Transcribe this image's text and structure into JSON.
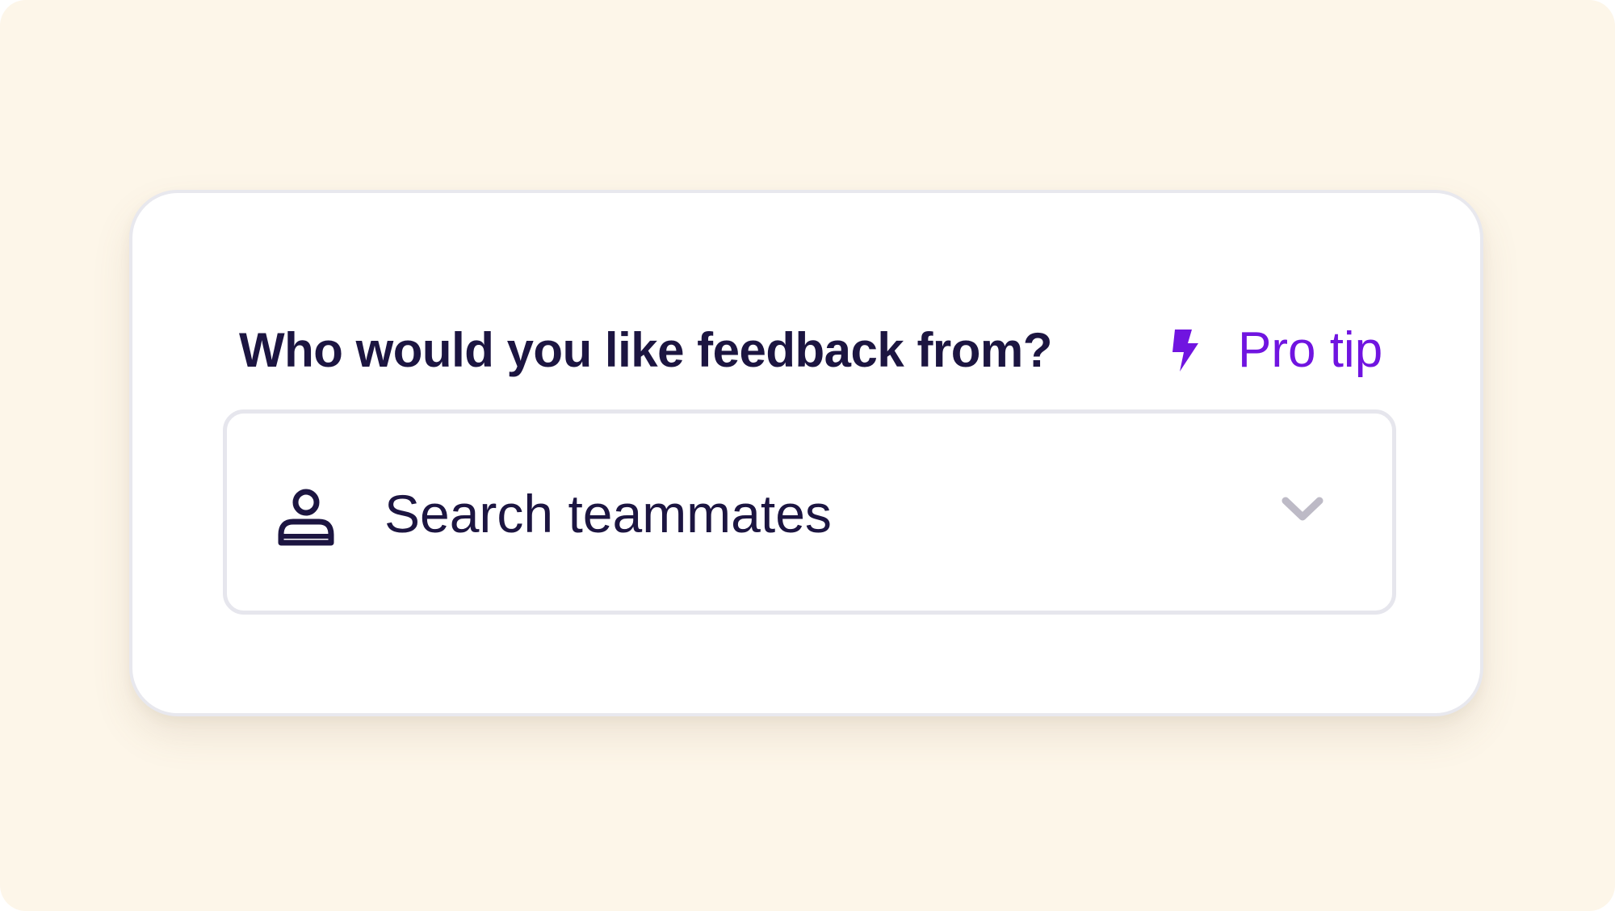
{
  "prompt": {
    "question": "Who would you like feedback from?",
    "pro_tip_label": "Pro tip",
    "pro_tip_icon": "lightning-bolt-icon"
  },
  "teammate_select": {
    "placeholder": "Search teammates",
    "leading_icon": "person-icon",
    "trailing_icon": "chevron-down-icon"
  },
  "colors": {
    "background": "#fdf6e9",
    "card": "#ffffff",
    "text_primary": "#1c1541",
    "accent": "#7014e0",
    "border": "#e6e6ed",
    "chevron": "#bdbac6"
  }
}
